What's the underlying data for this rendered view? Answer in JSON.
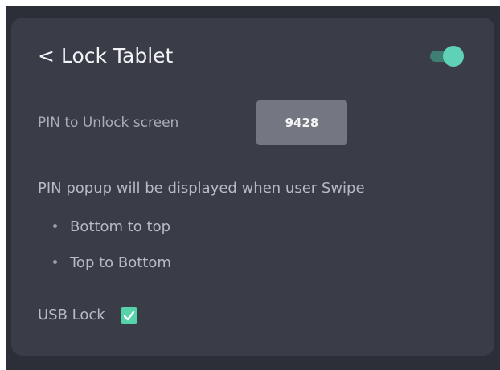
{
  "header": {
    "back_glyph": "<",
    "title": "Lock Tablet",
    "toggle_on": true
  },
  "pin": {
    "label": "PIN to Unlock screen",
    "value": "9428"
  },
  "swipe": {
    "description": "PIN popup will be displayed when user Swipe",
    "options": [
      "Bottom to top",
      "Top to Bottom"
    ]
  },
  "usb": {
    "label": "USB Lock",
    "checked": true
  },
  "colors": {
    "background": "#2c2f37",
    "panel": "#3a3d47",
    "accent": "#5fd1b6",
    "checkbox": "#56d3a9",
    "pin_box": "#747781"
  }
}
